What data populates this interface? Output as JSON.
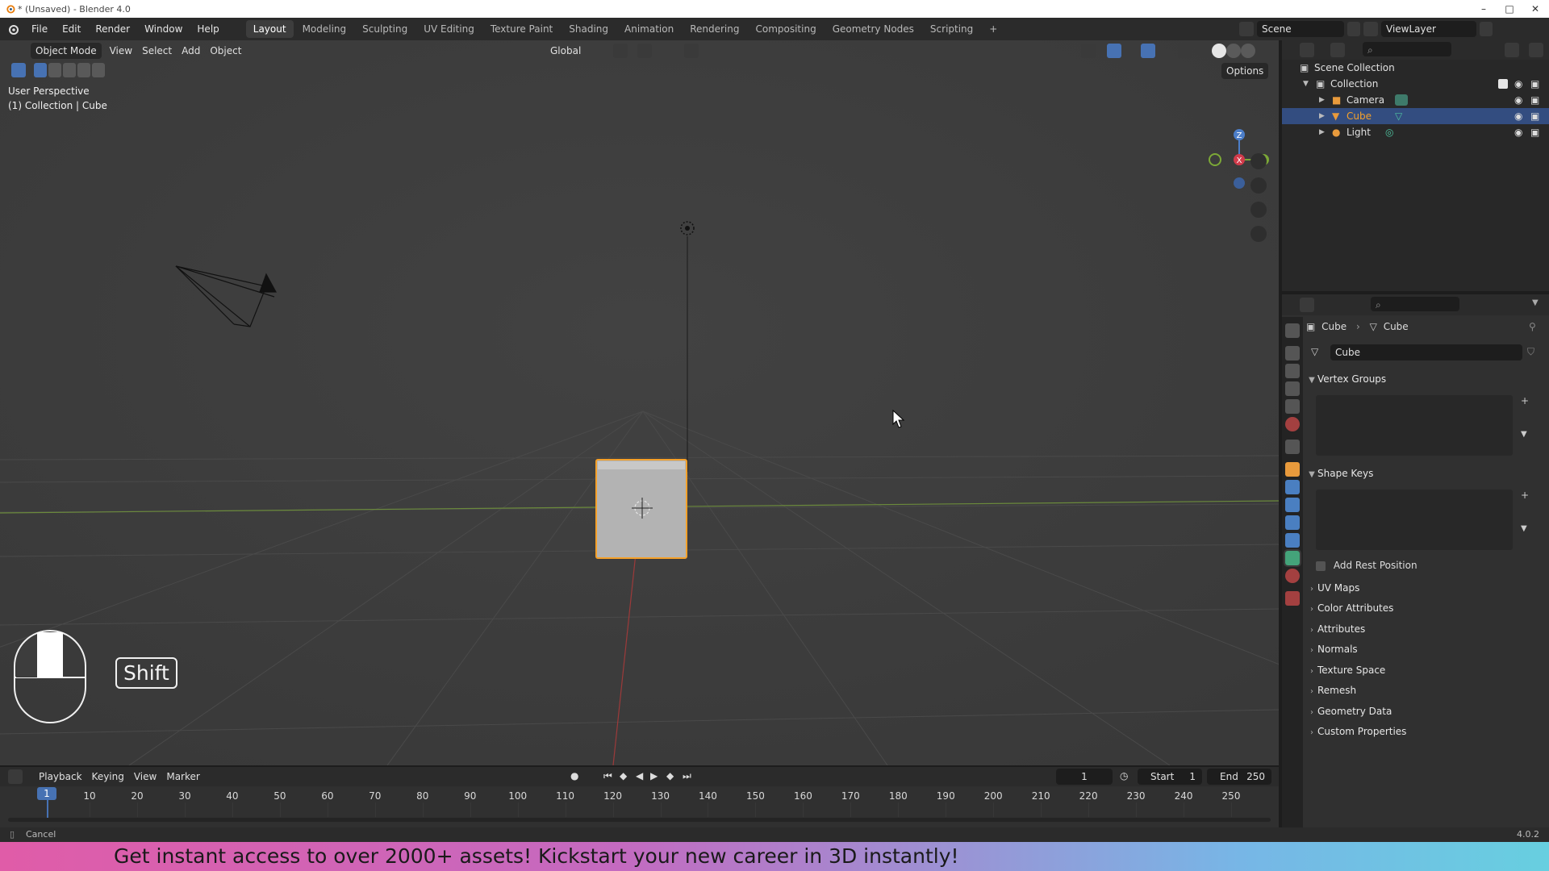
{
  "window": {
    "title": "* (Unsaved) - Blender 4.0"
  },
  "topbar": {
    "menus": [
      "File",
      "Edit",
      "Render",
      "Window",
      "Help"
    ],
    "workspaces": [
      "Layout",
      "Modeling",
      "Sculpting",
      "UV Editing",
      "Texture Paint",
      "Shading",
      "Animation",
      "Rendering",
      "Compositing",
      "Geometry Nodes",
      "Scripting"
    ],
    "active_workspace": "Layout",
    "add_tab": "+",
    "scene": "Scene",
    "view_layer": "ViewLayer"
  },
  "viewport": {
    "mode": "Object Mode",
    "menus": [
      "View",
      "Select",
      "Add",
      "Object"
    ],
    "transform_orientation": "Global",
    "options_label": "Options",
    "overlay_line1": "User Perspective",
    "overlay_line2": "(1) Collection | Cube",
    "gizmo": {
      "x": "X",
      "y": "Y",
      "z": "Z"
    },
    "key_hint": "Shift"
  },
  "outliner": {
    "root": "Scene Collection",
    "collection": "Collection",
    "items": [
      {
        "label": "Camera",
        "icon": "camera-icon",
        "selected": false
      },
      {
        "label": "Cube",
        "icon": "mesh-icon",
        "selected": true
      },
      {
        "label": "Light",
        "icon": "light-icon",
        "selected": false
      }
    ]
  },
  "properties": {
    "breadcrumb_object": "Cube",
    "breadcrumb_data": "Cube",
    "datablock_name": "Cube",
    "panels": {
      "vertex_groups": "Vertex Groups",
      "shape_keys": "Shape Keys",
      "add_rest_position": "Add Rest Position",
      "uv_maps": "UV Maps",
      "color_attributes": "Color Attributes",
      "attributes": "Attributes",
      "normals": "Normals",
      "texture_space": "Texture Space",
      "remesh": "Remesh",
      "geometry_data": "Geometry Data",
      "custom_properties": "Custom Properties"
    }
  },
  "timeline": {
    "menus": [
      "Playback",
      "Keying",
      "View",
      "Marker"
    ],
    "current_frame": "1",
    "start_label": "Start",
    "start_value": "1",
    "end_label": "End",
    "end_value": "250",
    "ticks": [
      "1",
      "10",
      "20",
      "30",
      "40",
      "50",
      "60",
      "70",
      "80",
      "90",
      "100",
      "110",
      "120",
      "130",
      "140",
      "150",
      "160",
      "170",
      "180",
      "190",
      "200",
      "210",
      "220",
      "230",
      "240",
      "250"
    ]
  },
  "statusbar": {
    "left": "Cancel",
    "version": "4.0.2"
  },
  "banner": {
    "text": "Get instant access to over 2000+ assets! Kickstart your new career in 3D instantly!"
  },
  "colors": {
    "selection": "#334d80",
    "active_outline": "#f5a12a",
    "accent": "#4772b3"
  }
}
